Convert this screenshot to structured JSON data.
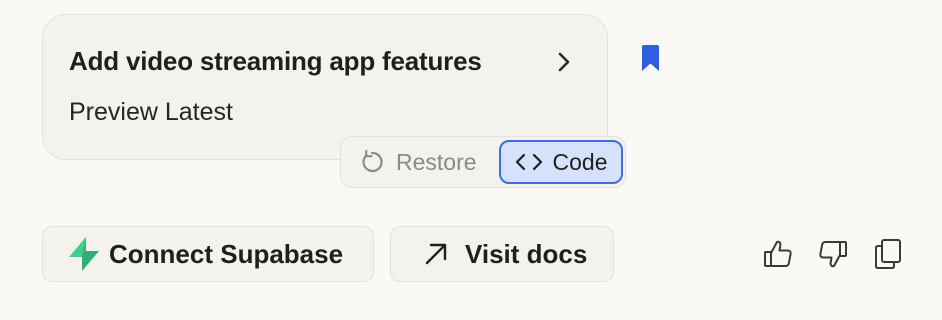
{
  "card": {
    "title": "Add video streaming app features",
    "subtitle": "Preview Latest"
  },
  "version_bar": {
    "restore_label": "Restore",
    "code_label": "Code"
  },
  "actions": {
    "supabase_label": "Connect Supabase",
    "docs_label": "Visit docs"
  },
  "icons": {
    "card_chevron": "chevron-right-icon",
    "bookmark": "bookmark-icon",
    "restore": "restore-icon",
    "code": "code-icon",
    "supabase": "supabase-logo",
    "docs": "arrow-up-right-icon",
    "thumbs_up": "thumbs-up-icon",
    "thumbs_down": "thumbs-down-icon",
    "copy": "copy-icon"
  },
  "colors": {
    "background": "#faf9f6",
    "card": "#f4f2ec",
    "accent_blue": "#2f5fe0",
    "code_selected_bg": "#d6e2fb",
    "code_selected_border": "#3b6fe0",
    "supabase_green": "#3ecf8e",
    "muted_text": "#8b8a85"
  }
}
